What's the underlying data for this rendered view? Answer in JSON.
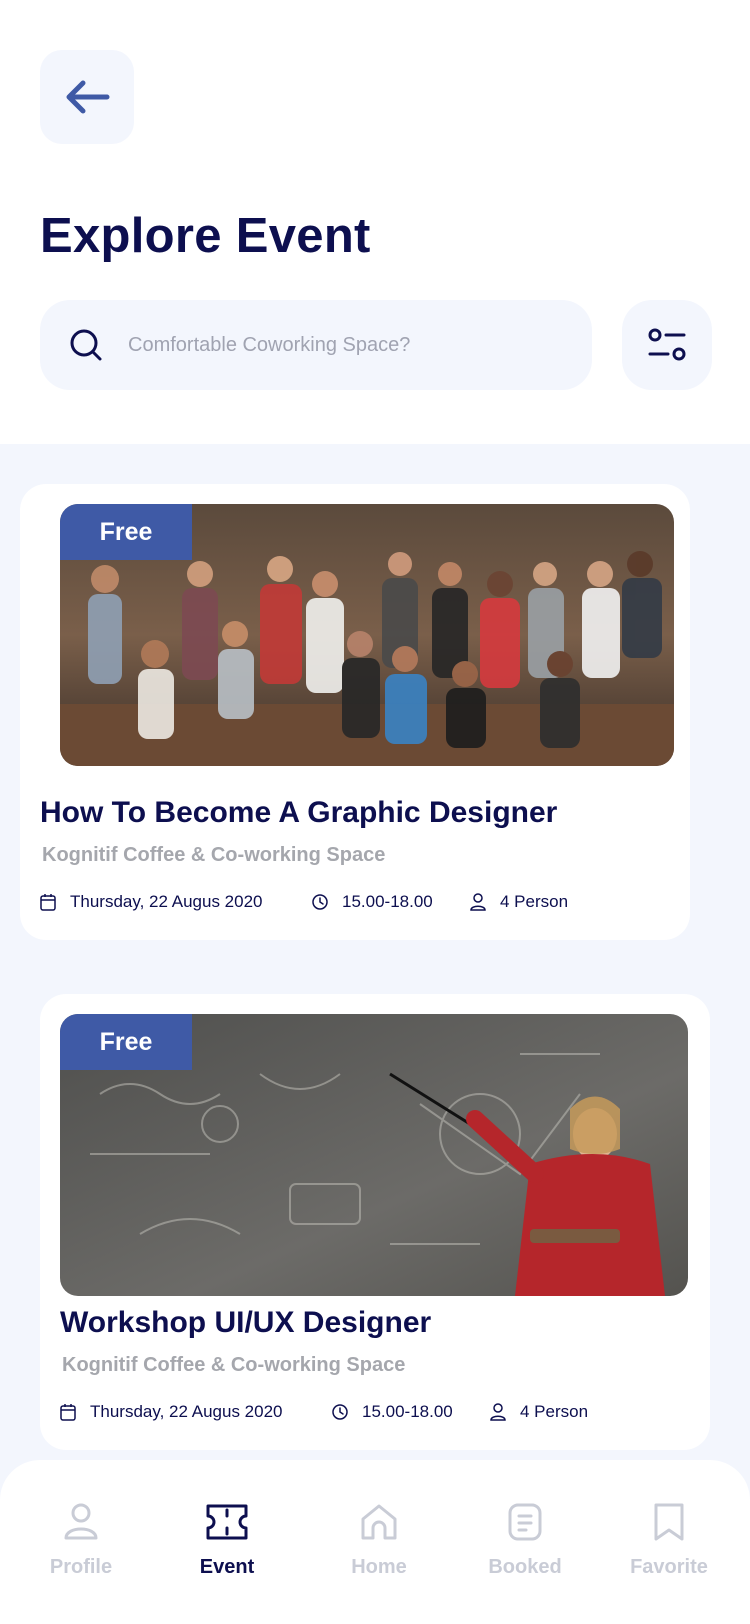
{
  "header": {
    "title": "Explore Event"
  },
  "search": {
    "placeholder": "Comfortable Coworking Space?"
  },
  "events": [
    {
      "badge": "Free",
      "title": "How To Become A Graphic Designer",
      "venue": "Kognitif Coffee & Co-working Space",
      "date": "Thursday, 22 Augus 2020",
      "time": "15.00-18.00",
      "capacity": "4 Person"
    },
    {
      "badge": "Free",
      "title": "Workshop UI/UX Designer",
      "venue": "Kognitif Coffee & Co-working Space",
      "date": "Thursday, 22 Augus 2020",
      "time": "15.00-18.00",
      "capacity": "4 Person"
    }
  ],
  "nav": {
    "items": [
      {
        "label": "Profile",
        "icon": "profile-icon"
      },
      {
        "label": "Event",
        "icon": "ticket-icon",
        "active": true
      },
      {
        "label": "Home",
        "icon": "home-icon"
      },
      {
        "label": "Booked",
        "icon": "booked-icon"
      },
      {
        "label": "Favorite",
        "icon": "bookmark-icon"
      }
    ]
  },
  "colors": {
    "primary": "#0d0f4f",
    "accent": "#3f5aa6",
    "surface": "#f3f6fd",
    "muted": "#a5a7ad",
    "inactive": "#c9ccd6"
  }
}
